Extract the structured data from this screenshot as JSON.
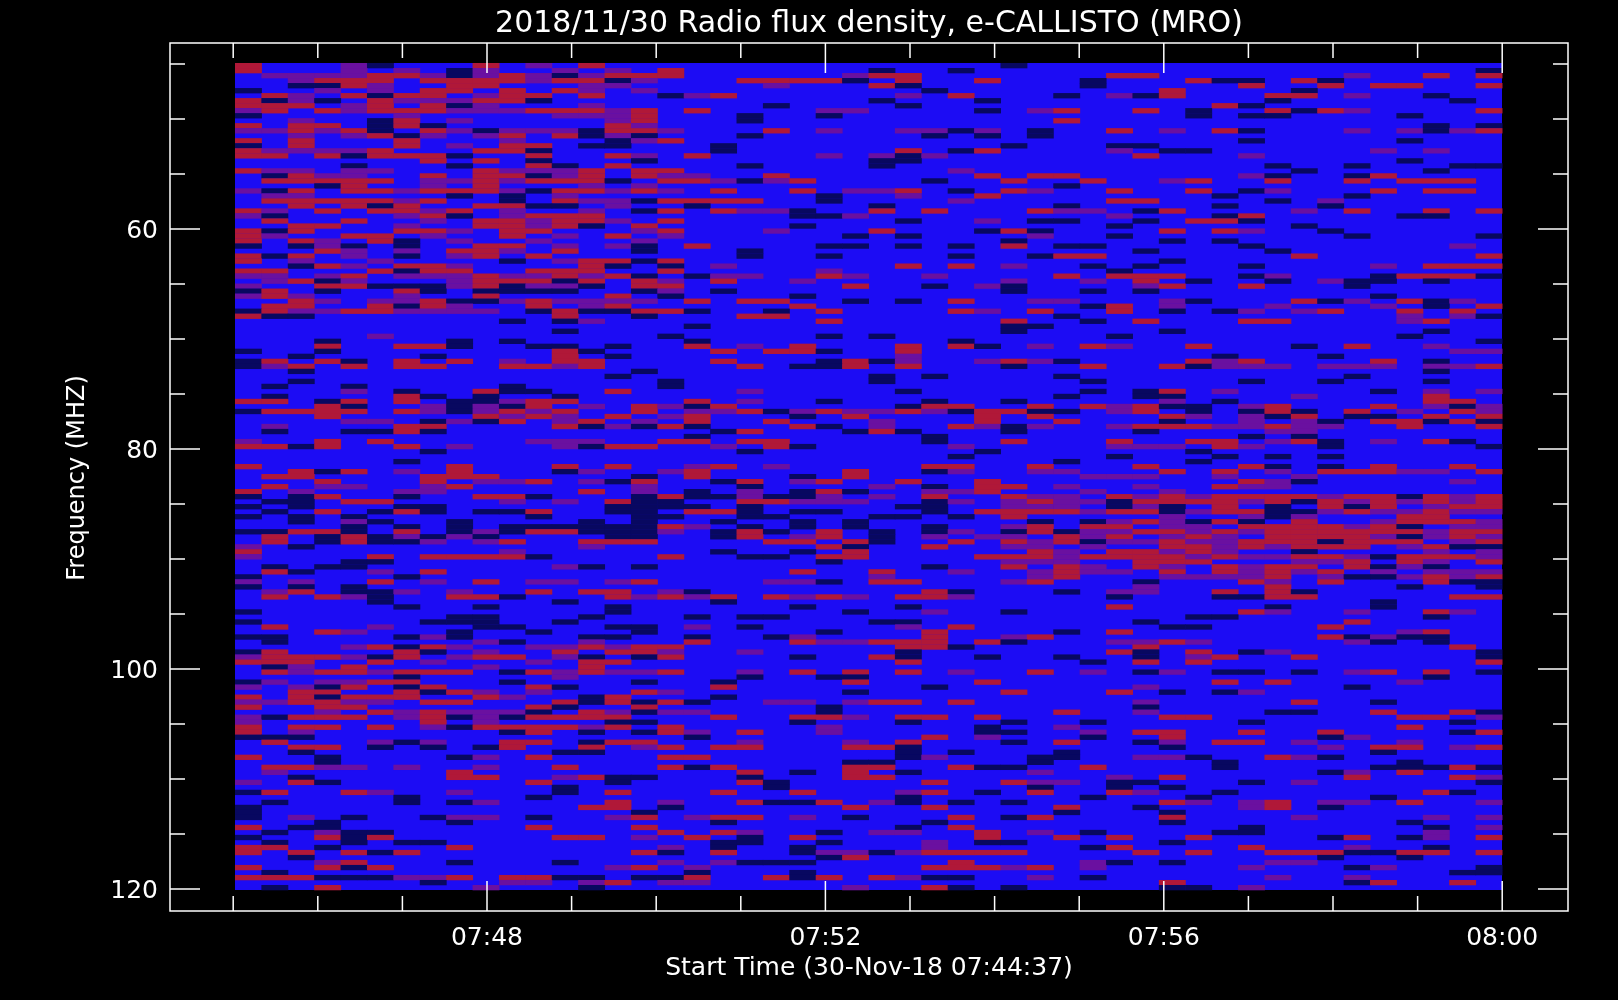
{
  "title": "2018/11/30  Radio flux density, e-CALLISTO (MRO)",
  "y_axis": {
    "label": "Frequency (MHZ)",
    "ticks": [
      "60",
      "80",
      "100",
      "120"
    ]
  },
  "x_axis": {
    "label": "Start Time (30-Nov-18 07:44:37)",
    "ticks": [
      "07:48",
      "07:52",
      "07:56",
      "08:00"
    ]
  }
}
